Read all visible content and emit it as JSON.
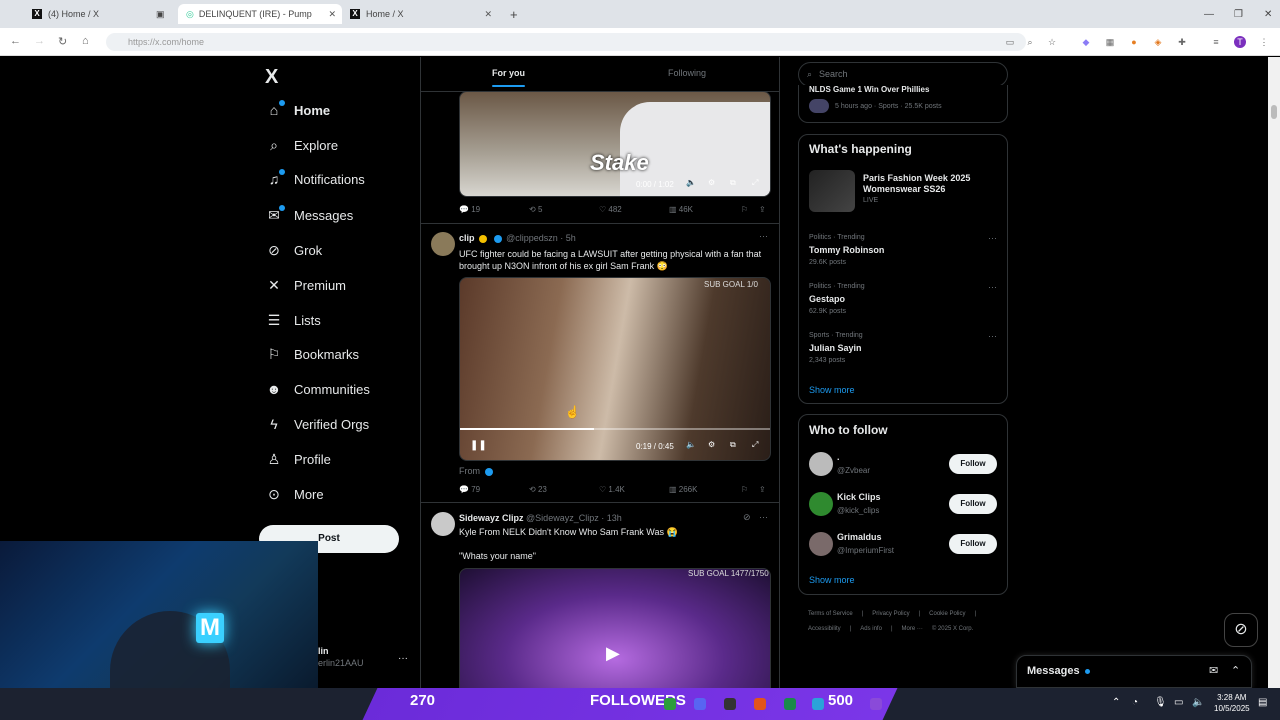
{
  "browser": {
    "tabs": [
      {
        "title": "(4) Home / X"
      },
      {
        "title": "DELINQUENT (IRE) - Pump"
      },
      {
        "title": "Home / X"
      }
    ],
    "new_tab": "+",
    "url": "https://x.com/home"
  },
  "nav": {
    "logo": "X",
    "items": [
      {
        "label": "Home",
        "icon": "home-icon"
      },
      {
        "label": "Explore",
        "icon": "search-icon"
      },
      {
        "label": "Notifications",
        "icon": "bell-icon"
      },
      {
        "label": "Messages",
        "icon": "mail-icon"
      },
      {
        "label": "Grok",
        "icon": "grok-icon"
      },
      {
        "label": "Premium",
        "icon": "x-icon"
      },
      {
        "label": "Lists",
        "icon": "list-icon"
      },
      {
        "label": "Bookmarks",
        "icon": "bookmark-icon"
      },
      {
        "label": "Communities",
        "icon": "people-icon"
      },
      {
        "label": "Verified Orgs",
        "icon": "bolt-icon"
      },
      {
        "label": "Profile",
        "icon": "person-icon"
      },
      {
        "label": "More",
        "icon": "more-circle-icon"
      }
    ],
    "post_button": "Post",
    "account_name": "lin",
    "account_handle": "erlin21AAU",
    "account_more": "···"
  },
  "feed": {
    "tabs": [
      "For you",
      "Following"
    ],
    "tweet1": {
      "video_time": "0:00 / 1:02",
      "stake_text": "Stake",
      "replies": "19",
      "reposts": "5",
      "likes": "482",
      "views": "46K"
    },
    "tweet2": {
      "name": "clip",
      "handle": "@clippedszn",
      "time": "· 5h",
      "text": "UFC fighter could be facing a LAWSUIT after getting physical with a fan that brought up N3ON infront of his ex girl Sam Frank 😳",
      "video_time": "0:19 / 0:45",
      "video_overlay": "SUB GOAL 1/0",
      "from": "From",
      "replies": "79",
      "reposts": "23",
      "likes": "1.4K",
      "views": "266K",
      "more": "···"
    },
    "tweet3": {
      "name": "Sidewayz Clipz",
      "handle": "@Sidewayz_Clipz",
      "time": "· 13h",
      "text": "Kyle From NELK Didn't Know Who Sam Frank Was 😭",
      "quote": "\"Whats your name\"",
      "video_overlay": "SUB GOAL 1477/1750",
      "more": "···"
    }
  },
  "right": {
    "search_placeholder": "Search",
    "top_news": {
      "title": "NLDS Game 1 Win Over Phillies",
      "meta": "5 hours ago · Sports · 25.5K posts"
    },
    "happening": {
      "title": "What's happening",
      "event_title": "Paris Fashion Week 2025 Womenswear SS26",
      "event_status": "LIVE",
      "trends": [
        {
          "meta": "Politics · Trending",
          "name": "Tommy Robinson",
          "posts": "29.6K posts"
        },
        {
          "meta": "Politics · Trending",
          "name": "Gestapo",
          "posts": "62.9K posts"
        },
        {
          "meta": "Sports · Trending",
          "name": "Julian Sayin",
          "posts": "2,343 posts"
        }
      ],
      "trend_more": "···",
      "show_more": "Show more"
    },
    "who_to_follow": {
      "title": "Who to follow",
      "accounts": [
        {
          "name": ".",
          "handle": "@Zvbear",
          "button": "Follow"
        },
        {
          "name": "Kick Clips",
          "handle": "@kick_clips",
          "button": "Follow"
        },
        {
          "name": "Grimaldus",
          "handle": "@ImperiumFirst",
          "button": "Follow"
        }
      ],
      "show_more": "Show more"
    },
    "footer": [
      "Terms of Service",
      "|",
      "Privacy Policy",
      "|",
      "Cookie Policy",
      "|",
      "Accessibility",
      "|",
      "Ads info",
      "|",
      "More ···",
      "© 2025 X Corp."
    ],
    "messages": "Messages"
  },
  "stream": {
    "count_left": "270",
    "label": "FOLLOWERS",
    "count_right": "500"
  },
  "taskbar": {
    "time": "3:28 AM",
    "date": "10/5/2025"
  },
  "colors": {
    "accent": "#1d9bf0",
    "background": "#000000",
    "overlay": "#7b36e8"
  }
}
